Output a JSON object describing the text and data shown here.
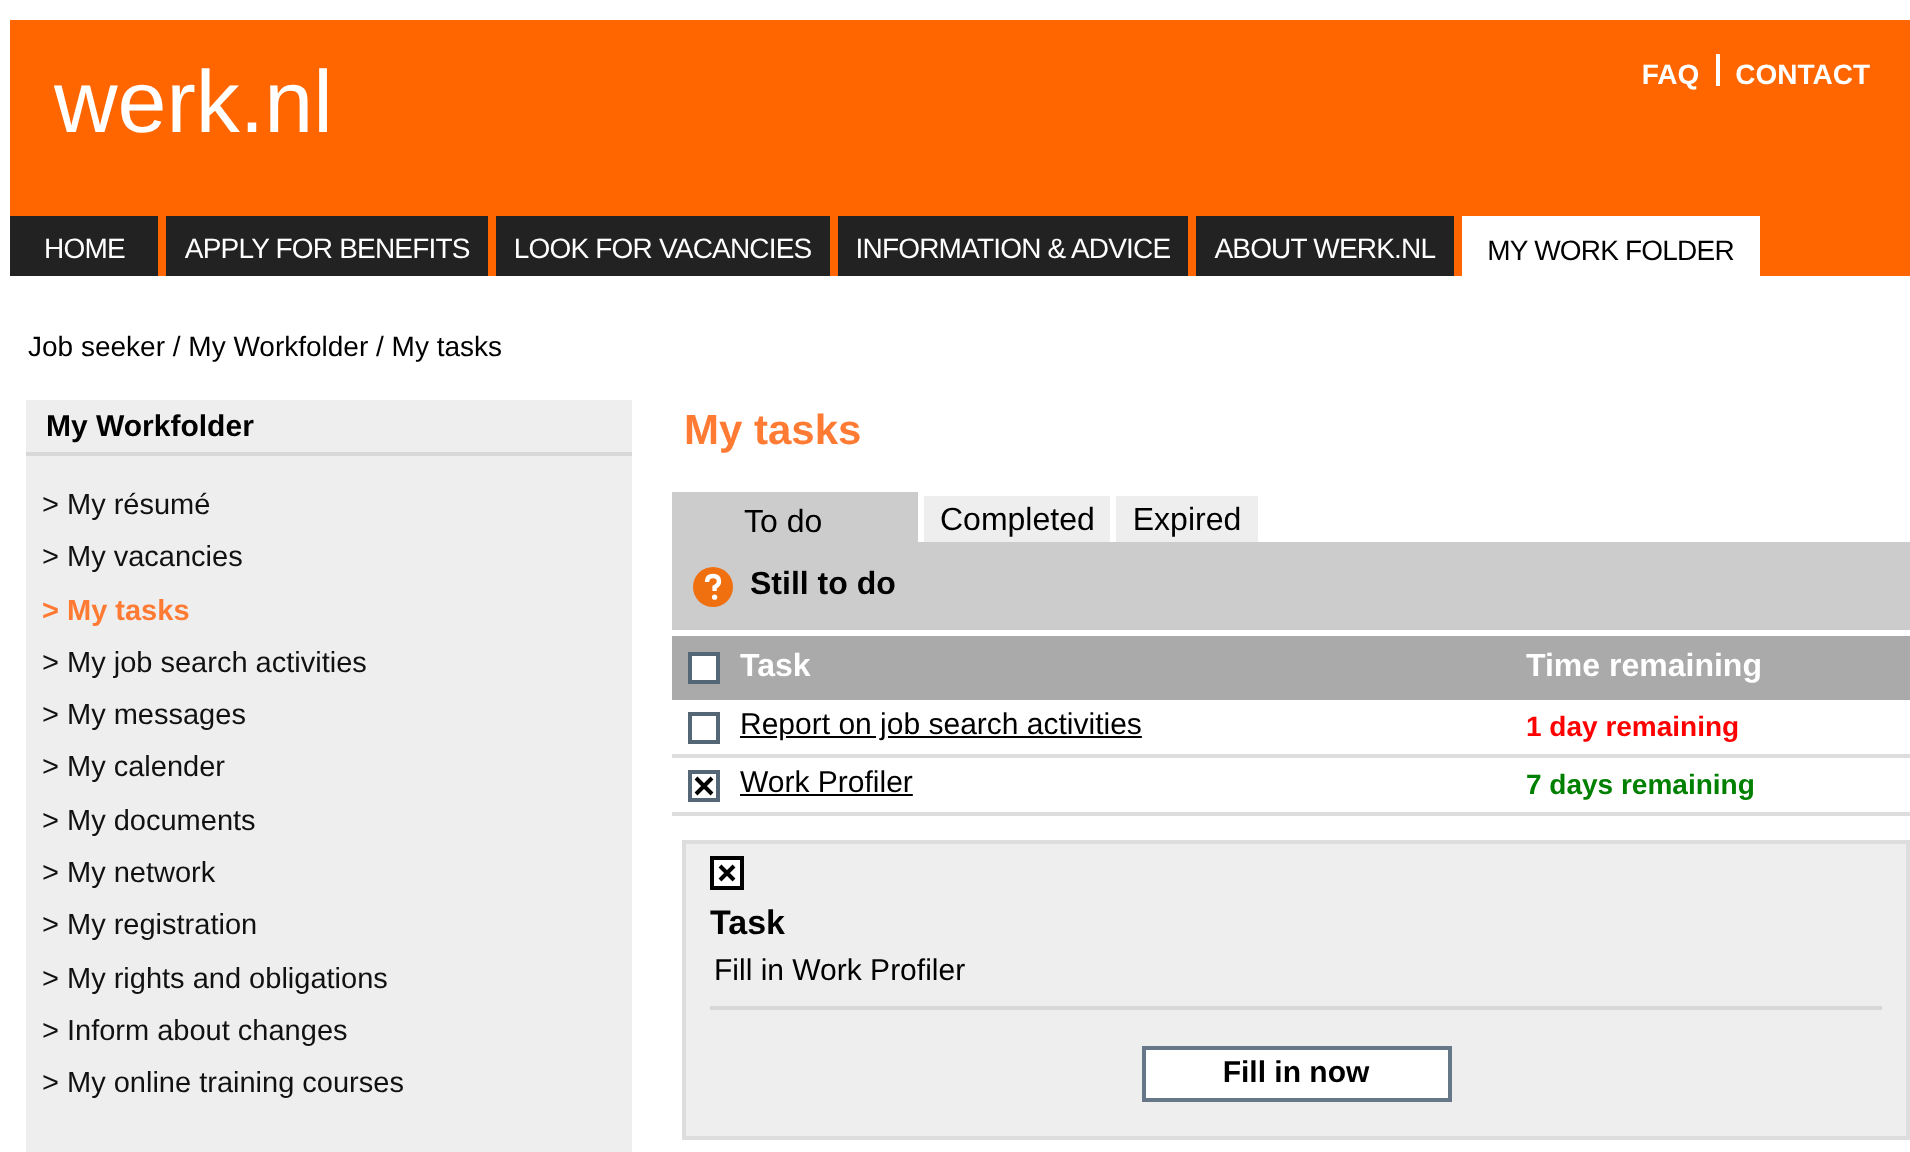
{
  "header": {
    "logo": "werk.nl",
    "links": [
      {
        "label": "FAQ"
      },
      {
        "label": "CONTACT"
      }
    ]
  },
  "nav": [
    {
      "label": "HOME",
      "selected": false
    },
    {
      "label": "APPLY FOR BENEFITS",
      "selected": false
    },
    {
      "label": "LOOK FOR VACANCIES",
      "selected": false
    },
    {
      "label": "INFORMATION & ADVICE",
      "selected": false
    },
    {
      "label": "ABOUT WERK.NL",
      "selected": false
    },
    {
      "label": "MY WORK FOLDER",
      "selected": true
    }
  ],
  "breadcrumb": "Job seeker / My Workfolder / My tasks",
  "sidebar": {
    "title": "My Workfolder",
    "items": [
      {
        "label": "> My résumé",
        "selected": false
      },
      {
        "label": "> My vacancies",
        "selected": false
      },
      {
        "label": "> My tasks",
        "selected": true
      },
      {
        "label": "> My job search activities",
        "selected": false
      },
      {
        "label": "> My messages",
        "selected": false
      },
      {
        "label": "> My calender",
        "selected": false
      },
      {
        "label": "> My documents",
        "selected": false
      },
      {
        "label": "> My network",
        "selected": false
      },
      {
        "label": "> My registration",
        "selected": false
      },
      {
        "label": "> My rights and obligations",
        "selected": false
      },
      {
        "label": "> Inform about changes",
        "selected": false
      },
      {
        "label": "> My online training courses",
        "selected": false
      }
    ]
  },
  "main": {
    "title": "My tasks",
    "tabs": [
      {
        "label": "To do",
        "selected": true
      },
      {
        "label": "Completed",
        "selected": false
      },
      {
        "label": "Expired",
        "selected": false
      }
    ],
    "section_title": "Still to do",
    "table": {
      "columns": [
        "Task",
        "Time remaining"
      ],
      "header_checked": false,
      "rows": [
        {
          "task": "Report on job search activities",
          "time_remaining": "1 day remaining",
          "color": "#ff0000",
          "checked": false
        },
        {
          "task": "Work Profiler",
          "time_remaining": "7 days remaining",
          "color": "#008000",
          "checked": true
        }
      ]
    },
    "detail": {
      "heading": "Task",
      "text": "Fill in Work Profiler",
      "button": "Fill in now"
    }
  }
}
